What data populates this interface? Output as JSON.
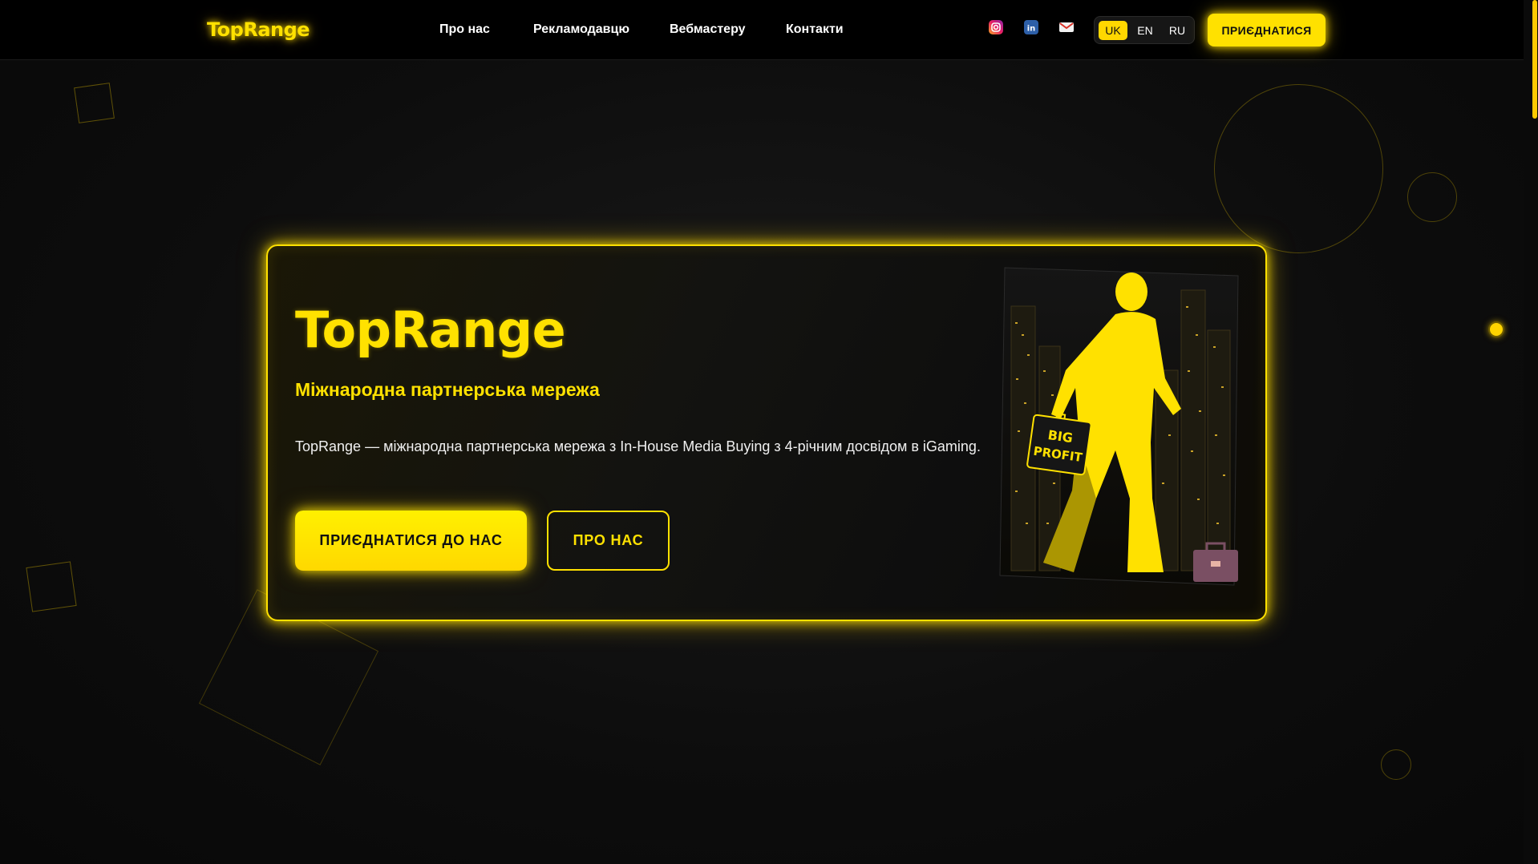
{
  "header": {
    "logo": "TopRange",
    "nav": [
      {
        "label": "Про нас"
      },
      {
        "label": "Рекламодавцю"
      },
      {
        "label": "Вебмастеру"
      },
      {
        "label": "Контакти"
      }
    ],
    "social_icons": [
      "instagram-icon",
      "linkedin-icon",
      "mail-icon"
    ],
    "languages": [
      {
        "code": "UK",
        "active": true
      },
      {
        "code": "EN",
        "active": false
      },
      {
        "code": "RU",
        "active": false
      }
    ],
    "join_button": "ПРИЄДНАТИСЯ"
  },
  "hero": {
    "title": "TopRange",
    "subtitle": "Міжнародна партнерська мережа",
    "description": "TopRange — міжнародна партнерська мережа з In-House Media Buying з 4-річним досвідом в iGaming.",
    "primary_button": "ПРИЄДНАТИСЯ ДО НАС",
    "secondary_button": "ПРО НАС",
    "illustration": {
      "briefcase_line1": "BIG",
      "briefcase_line2": "PROFIT"
    }
  },
  "colors": {
    "accent": "#ffe100",
    "background": "#0b0b0b",
    "header_bg": "#000000"
  }
}
